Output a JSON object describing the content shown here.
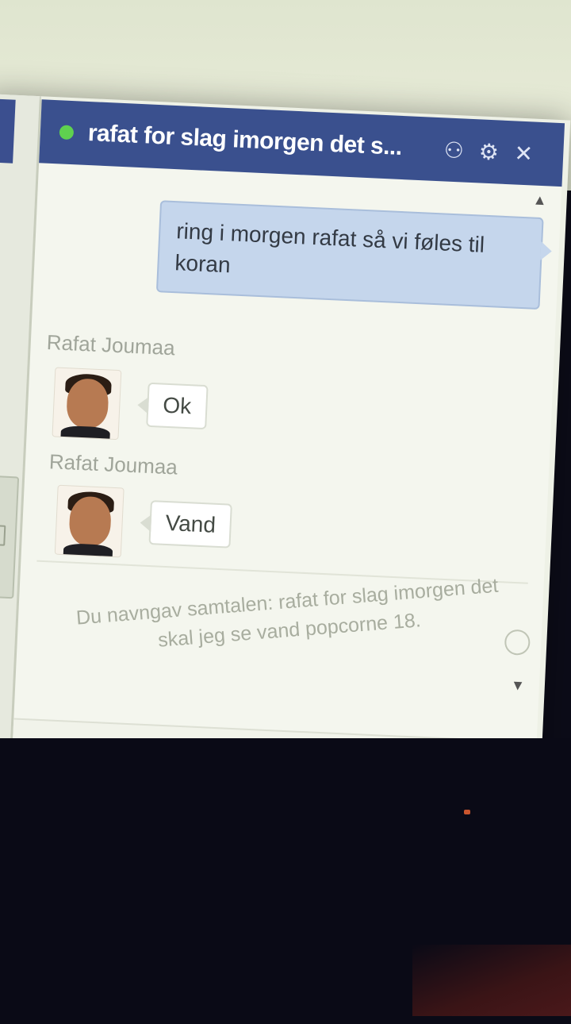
{
  "chat": {
    "title": "rafat for slag imorgen det s...",
    "status": "online",
    "controls": {
      "call": "⚇",
      "settings": "⚙",
      "close": "✕"
    }
  },
  "messages": {
    "outgoing_text": "ring i morgen rafat så vi føles til koran",
    "incoming": [
      {
        "sender": "Rafat Joumaa",
        "text": "Ok"
      },
      {
        "sender": "Rafat Joumaa",
        "text": "Vand"
      }
    ],
    "system_note": "Du navngav samtalen: rafat for slag imorgen det skal jeg se vand popcorne 18."
  },
  "scroll": {
    "up": "▲",
    "down": "▼"
  },
  "colors": {
    "titlebar": "#3a508e",
    "status_online": "#5fd14f",
    "outgoing_bubble": "#c5d6ec"
  }
}
